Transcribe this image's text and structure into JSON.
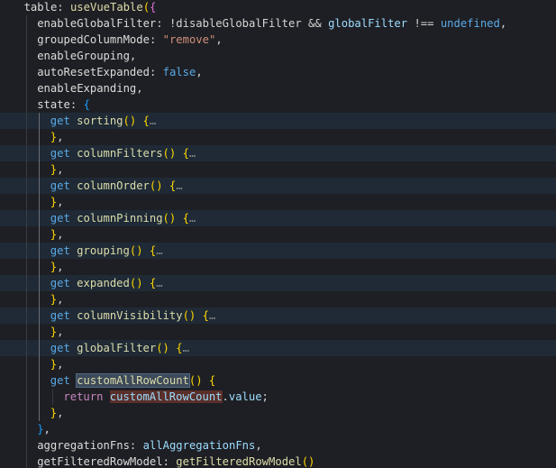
{
  "lines": [
    {
      "indent": 1,
      "hl": false,
      "tokens": [
        {
          "t": "table",
          "c": "prop2"
        },
        {
          "t": ": ",
          "c": "plain"
        },
        {
          "t": "useVueTable",
          "c": "fn"
        },
        {
          "t": "(",
          "c": "brace-y"
        },
        {
          "t": "{",
          "c": "brace-p"
        }
      ]
    },
    {
      "indent": 2,
      "hl": false,
      "tokens": [
        {
          "t": "enableGlobalFilter",
          "c": "prop2"
        },
        {
          "t": ": !",
          "c": "plain"
        },
        {
          "t": "disableGlobalFilter",
          "c": "plain"
        },
        {
          "t": " && ",
          "c": "plain"
        },
        {
          "t": "globalFilter",
          "c": "var"
        },
        {
          "t": " !== ",
          "c": "plain"
        },
        {
          "t": "undefined",
          "c": "kw"
        },
        {
          "t": ",",
          "c": "plain"
        }
      ]
    },
    {
      "indent": 2,
      "hl": false,
      "tokens": [
        {
          "t": "groupedColumnMode",
          "c": "prop2"
        },
        {
          "t": ": ",
          "c": "plain"
        },
        {
          "t": "\"remove\"",
          "c": "str"
        },
        {
          "t": ",",
          "c": "plain"
        }
      ]
    },
    {
      "indent": 2,
      "hl": false,
      "tokens": [
        {
          "t": "enableGrouping",
          "c": "prop2"
        },
        {
          "t": ",",
          "c": "plain"
        }
      ]
    },
    {
      "indent": 2,
      "hl": false,
      "tokens": [
        {
          "t": "autoResetExpanded",
          "c": "prop2"
        },
        {
          "t": ": ",
          "c": "plain"
        },
        {
          "t": "false",
          "c": "kw"
        },
        {
          "t": ",",
          "c": "plain"
        }
      ]
    },
    {
      "indent": 2,
      "hl": false,
      "tokens": [
        {
          "t": "enableExpanding",
          "c": "prop2"
        },
        {
          "t": ",",
          "c": "plain"
        }
      ]
    },
    {
      "indent": 2,
      "hl": false,
      "tokens": [
        {
          "t": "state",
          "c": "prop2"
        },
        {
          "t": ": ",
          "c": "plain"
        },
        {
          "t": "{",
          "c": "brace-b"
        }
      ]
    },
    {
      "indent": 3,
      "hl": true,
      "tokens": [
        {
          "t": "get ",
          "c": "kw"
        },
        {
          "t": "sorting",
          "c": "fn"
        },
        {
          "t": "() ",
          "c": "brace-y"
        },
        {
          "t": "{",
          "c": "brace-y"
        },
        {
          "t": "…",
          "c": "fold"
        }
      ]
    },
    {
      "indent": 3,
      "hl": false,
      "tokens": [
        {
          "t": "}",
          "c": "brace-y"
        },
        {
          "t": ",",
          "c": "plain"
        }
      ]
    },
    {
      "indent": 3,
      "hl": true,
      "tokens": [
        {
          "t": "get ",
          "c": "kw"
        },
        {
          "t": "columnFilters",
          "c": "fn"
        },
        {
          "t": "() ",
          "c": "brace-y"
        },
        {
          "t": "{",
          "c": "brace-y"
        },
        {
          "t": "…",
          "c": "fold"
        }
      ]
    },
    {
      "indent": 3,
      "hl": false,
      "tokens": [
        {
          "t": "}",
          "c": "brace-y"
        },
        {
          "t": ",",
          "c": "plain"
        }
      ]
    },
    {
      "indent": 3,
      "hl": true,
      "tokens": [
        {
          "t": "get ",
          "c": "kw"
        },
        {
          "t": "columnOrder",
          "c": "fn"
        },
        {
          "t": "() ",
          "c": "brace-y"
        },
        {
          "t": "{",
          "c": "brace-y"
        },
        {
          "t": "…",
          "c": "fold"
        }
      ]
    },
    {
      "indent": 3,
      "hl": false,
      "tokens": [
        {
          "t": "}",
          "c": "brace-y"
        },
        {
          "t": ",",
          "c": "plain"
        }
      ]
    },
    {
      "indent": 3,
      "hl": true,
      "tokens": [
        {
          "t": "get ",
          "c": "kw"
        },
        {
          "t": "columnPinning",
          "c": "fn"
        },
        {
          "t": "() ",
          "c": "brace-y"
        },
        {
          "t": "{",
          "c": "brace-y"
        },
        {
          "t": "…",
          "c": "fold"
        }
      ]
    },
    {
      "indent": 3,
      "hl": false,
      "tokens": [
        {
          "t": "}",
          "c": "brace-y"
        },
        {
          "t": ",",
          "c": "plain"
        }
      ]
    },
    {
      "indent": 3,
      "hl": true,
      "tokens": [
        {
          "t": "get ",
          "c": "kw"
        },
        {
          "t": "grouping",
          "c": "fn"
        },
        {
          "t": "() ",
          "c": "brace-y"
        },
        {
          "t": "{",
          "c": "brace-y"
        },
        {
          "t": "…",
          "c": "fold"
        }
      ]
    },
    {
      "indent": 3,
      "hl": false,
      "tokens": [
        {
          "t": "}",
          "c": "brace-y"
        },
        {
          "t": ",",
          "c": "plain"
        }
      ]
    },
    {
      "indent": 3,
      "hl": true,
      "tokens": [
        {
          "t": "get ",
          "c": "kw"
        },
        {
          "t": "expanded",
          "c": "fn"
        },
        {
          "t": "() ",
          "c": "brace-y"
        },
        {
          "t": "{",
          "c": "brace-y"
        },
        {
          "t": "…",
          "c": "fold"
        }
      ]
    },
    {
      "indent": 3,
      "hl": false,
      "tokens": [
        {
          "t": "}",
          "c": "brace-y"
        },
        {
          "t": ",",
          "c": "plain"
        }
      ]
    },
    {
      "indent": 3,
      "hl": true,
      "tokens": [
        {
          "t": "get ",
          "c": "kw"
        },
        {
          "t": "columnVisibility",
          "c": "fn"
        },
        {
          "t": "() ",
          "c": "brace-y"
        },
        {
          "t": "{",
          "c": "brace-y"
        },
        {
          "t": "…",
          "c": "fold"
        }
      ]
    },
    {
      "indent": 3,
      "hl": false,
      "tokens": [
        {
          "t": "}",
          "c": "brace-y"
        },
        {
          "t": ",",
          "c": "plain"
        }
      ]
    },
    {
      "indent": 3,
      "hl": true,
      "tokens": [
        {
          "t": "get ",
          "c": "kw"
        },
        {
          "t": "globalFilter",
          "c": "fn"
        },
        {
          "t": "() ",
          "c": "brace-y"
        },
        {
          "t": "{",
          "c": "brace-y"
        },
        {
          "t": "…",
          "c": "fold"
        }
      ]
    },
    {
      "indent": 3,
      "hl": false,
      "tokens": [
        {
          "t": "}",
          "c": "brace-y"
        },
        {
          "t": ",",
          "c": "plain"
        }
      ]
    },
    {
      "indent": 3,
      "hl": false,
      "tokens": [
        {
          "t": "get ",
          "c": "kw"
        },
        {
          "t": "customAllRowCount",
          "c": "fn",
          "mark": "sel"
        },
        {
          "t": "() ",
          "c": "brace-y"
        },
        {
          "t": "{",
          "c": "brace-y"
        }
      ]
    },
    {
      "indent": 4,
      "hl": false,
      "tokens": [
        {
          "t": "return ",
          "c": "kw2"
        },
        {
          "t": "customAllRowCount",
          "c": "var",
          "mark": "ref"
        },
        {
          "t": ".",
          "c": "plain"
        },
        {
          "t": "value",
          "c": "var"
        },
        {
          "t": ";",
          "c": "plain"
        }
      ]
    },
    {
      "indent": 3,
      "hl": false,
      "tokens": [
        {
          "t": "}",
          "c": "brace-y"
        },
        {
          "t": ",",
          "c": "plain"
        }
      ]
    },
    {
      "indent": 2,
      "hl": false,
      "tokens": [
        {
          "t": "}",
          "c": "brace-b"
        },
        {
          "t": ",",
          "c": "plain"
        }
      ]
    },
    {
      "indent": 2,
      "hl": false,
      "tokens": [
        {
          "t": "aggregationFns",
          "c": "prop2"
        },
        {
          "t": ": ",
          "c": "plain"
        },
        {
          "t": "allAggregationFns",
          "c": "var"
        },
        {
          "t": ",",
          "c": "plain"
        }
      ]
    },
    {
      "indent": 2,
      "hl": false,
      "tokens": [
        {
          "t": "getFilteredRowModel",
          "c": "prop2"
        },
        {
          "t": ": ",
          "c": "plain"
        },
        {
          "t": "getFilteredRowModel",
          "c": "fn"
        },
        {
          "t": "()",
          "c": "brace-y"
        }
      ]
    }
  ]
}
